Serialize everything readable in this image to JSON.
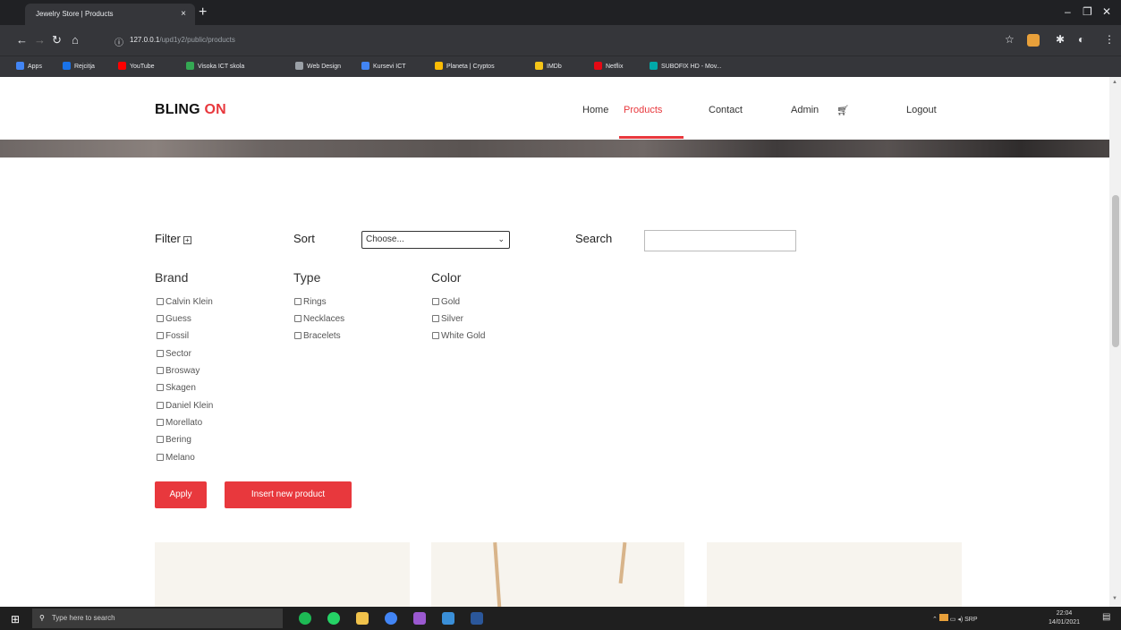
{
  "browser": {
    "tab_title": "Jewelry Store | Products",
    "tab_close": "×",
    "new_tab": "+",
    "url_host": "127.0.0.1",
    "url_path": "/upd1y2/public/products",
    "bookmarks": [
      {
        "label": "Apps",
        "color": "#4285f4"
      },
      {
        "label": "Rejcitja",
        "color": "#1a73e8"
      },
      {
        "label": "YouTube",
        "color": "#ff0000"
      },
      {
        "label": "Visoka ICT skola",
        "color": "#34a853"
      },
      {
        "label": "Web Design",
        "color": "#9aa0a6"
      },
      {
        "label": "Kursevi ICT",
        "color": "#4285f4"
      },
      {
        "label": "Planeta | Cryptos",
        "color": "#fbbc04"
      },
      {
        "label": "IMDb",
        "color": "#f5c518"
      },
      {
        "label": "Netflix",
        "color": "#e50914"
      },
      {
        "label": "SUBOFIX HD - Mov...",
        "color": "#00a8a8"
      }
    ]
  },
  "site": {
    "brand_main": "BLING",
    "brand_accent": "ON",
    "nav": [
      {
        "label": "Home",
        "active": false
      },
      {
        "label": "Products",
        "active": true
      },
      {
        "label": "Contact",
        "active": false
      },
      {
        "label": "Admin",
        "active": false
      },
      {
        "label": "Logout",
        "active": false
      }
    ]
  },
  "filters": {
    "filter_label": "Filter",
    "sort_label": "Sort",
    "sort_selected": "Choose...",
    "search_label": "Search",
    "search_value": "",
    "brand_title": "Brand",
    "brands": [
      "Calvin Klein",
      "Guess",
      "Fossil",
      "Sector",
      "Brosway",
      "Skagen",
      "Daniel Klein",
      "Morellato",
      "Bering",
      "Melano"
    ],
    "type_title": "Type",
    "types": [
      "Rings",
      "Necklaces",
      "Bracelets"
    ],
    "color_title": "Color",
    "colors": [
      "Gold",
      "Silver",
      "White Gold"
    ],
    "apply_label": "Apply",
    "insert_label": "Insert new product"
  },
  "taskbar": {
    "search_placeholder": "Type here to search",
    "tray_text": "SRP",
    "time": "22:04",
    "date": "14/01/2021"
  }
}
